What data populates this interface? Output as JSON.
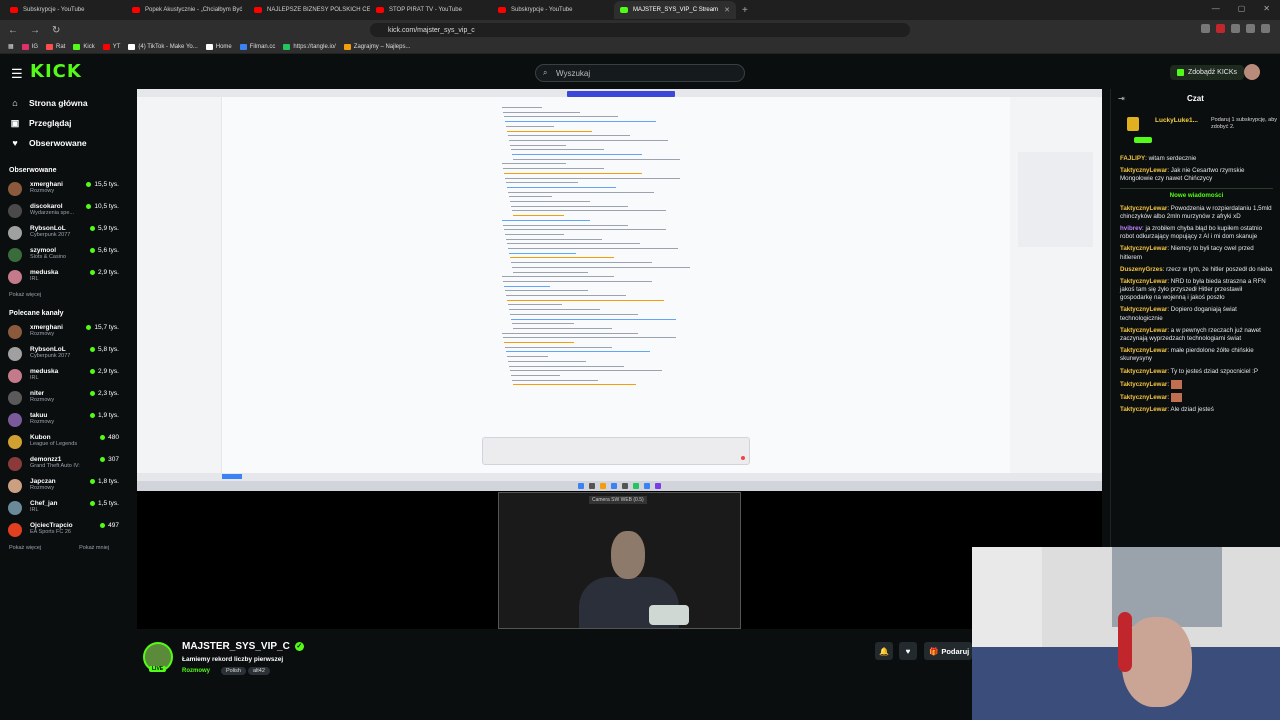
{
  "browser": {
    "tabs": [
      {
        "title": "Subskrypcje - YouTube",
        "color": "#ff0000",
        "active": false
      },
      {
        "title": "Popek Akustycznie - „Chciałbym Być",
        "color": "#ff0000",
        "active": false
      },
      {
        "title": "NAJLEPSZE BIZNESY POLSKICH CELE",
        "color": "#ff0000",
        "active": false
      },
      {
        "title": "STOP PIRAT TV - YouTube",
        "color": "#ff0000",
        "active": false
      },
      {
        "title": "Subskrypcje - YouTube",
        "color": "#ff0000",
        "active": false
      },
      {
        "title": "MAJSTER_SYS_VIP_C Stream",
        "color": "#53fc18",
        "active": true
      }
    ],
    "url": "kick.com/majster_sys_vip_c",
    "bookmarks": [
      {
        "label": "IG",
        "color": "#e1306c"
      },
      {
        "label": "Rat",
        "color": "#ff4d4d"
      },
      {
        "label": "Kick",
        "color": "#53fc18"
      },
      {
        "label": "YT",
        "color": "#ff0000"
      },
      {
        "label": "(4) TikTok - Make Yo...",
        "color": "#ffffff"
      },
      {
        "label": "Home",
        "color": "#ffffff"
      },
      {
        "label": "Filman.cc",
        "color": "#3b82f6"
      },
      {
        "label": "https://tangle.io/",
        "color": "#22c55e"
      },
      {
        "label": "Zagrajmy – Najleps...",
        "color": "#f59e0b"
      }
    ]
  },
  "header": {
    "logo": "KICK",
    "search_placeholder": "Wyszukaj",
    "kicks_label": "Zdobądź KICKs"
  },
  "sidebar": {
    "nav": [
      {
        "label": "Strona główna",
        "icon": "⌂"
      },
      {
        "label": "Przeglądaj",
        "icon": "▣"
      },
      {
        "label": "Obserwowane",
        "icon": "♥"
      }
    ],
    "followed_title": "Obserwowane",
    "followed": [
      {
        "name": "xmerghani",
        "cat": "Rozmowy",
        "viewers": "15,5 tys.",
        "color": "#8b5a3c"
      },
      {
        "name": "discokarol",
        "cat": "Wydarzenia spe...",
        "viewers": "10,5 tys.",
        "color": "#4a4a4a"
      },
      {
        "name": "RybsonLoL",
        "cat": "Cyberpunk 2077",
        "viewers": "5,9 tys.",
        "color": "#a0a0a0"
      },
      {
        "name": "szymool",
        "cat": "Slots & Casino",
        "viewers": "5,6 tys.",
        "color": "#3a6b3a"
      },
      {
        "name": "meduska",
        "cat": "IRL",
        "viewers": "2,9 tys.",
        "color": "#c47a8a"
      }
    ],
    "followed_more": "Pokaż więcej",
    "rec_title": "Polecane kanały",
    "recommended": [
      {
        "name": "xmerghani",
        "cat": "Rozmowy",
        "viewers": "15,7 tys.",
        "color": "#8b5a3c"
      },
      {
        "name": "RybsonLoL",
        "cat": "Cyberpunk 2077",
        "viewers": "5,8 tys.",
        "color": "#a0a0a0"
      },
      {
        "name": "meduska",
        "cat": "IRL",
        "viewers": "2,9 tys.",
        "color": "#c47a8a"
      },
      {
        "name": "niter",
        "cat": "Rozmowy",
        "viewers": "2,3 tys.",
        "color": "#5a5a5a"
      },
      {
        "name": "takuu",
        "cat": "Rozmowy",
        "viewers": "1,9 tys.",
        "color": "#7a5a9a"
      },
      {
        "name": "Kubon",
        "cat": "League of Legends",
        "viewers": "480",
        "color": "#d0a030"
      },
      {
        "name": "demonzz1",
        "cat": "Grand Theft Auto IV:...",
        "viewers": "307",
        "color": "#8a3a3a"
      },
      {
        "name": "Japczan",
        "cat": "Rozmowy",
        "viewers": "1,8 tys.",
        "color": "#caa080"
      },
      {
        "name": "Chef_jan",
        "cat": "IRL",
        "viewers": "1,5 tys.",
        "color": "#6a8a9a"
      },
      {
        "name": "OjciecTrapcio",
        "cat": "EA Sports FC 26",
        "viewers": "497",
        "color": "#e04020"
      }
    ],
    "rec_more": "Pokaż więcej",
    "rec_less": "Pokaż mniej"
  },
  "stream": {
    "channel": "MAJSTER_SYS_VIP_C",
    "title": "Łamiemy rekord liczby pierwszej",
    "category": "Rozmowy",
    "tags": [
      "Polish",
      "alt42"
    ],
    "live_badge": "LIVE",
    "gift_label": "Podaruj",
    "webcam_label": "Camera SW WEB (0.5)"
  },
  "chat": {
    "title": "Czat",
    "pinned_user": "LuckyLuke1...",
    "pinned_text": "Podaruj 1 subskrypcję, aby zdobyć 2.",
    "messages": [
      {
        "user": "FAJLIPY",
        "text": "witam serdecznie",
        "color": "c1"
      },
      {
        "user": "TaktycznyLewar",
        "text": "Jak nie Cesartwo rzymskie Mongołowie czy nawet Chińczycy",
        "color": "c1"
      }
    ],
    "new_label": "Nowe wiadomości",
    "messages2": [
      {
        "user": "TaktycznyLewar",
        "text": "Powodzenia w rozpierdalaniu 1,5mld chinczyków albo 2mln murzynów z afryki xD",
        "color": "c1"
      },
      {
        "user": "hvibrev",
        "text": "ja zrobiłem chyba błąd bo kupiłem ostatnio robot odkurzający mopujący z AI i mi dom skanuje",
        "color": "c2"
      },
      {
        "user": "TaktycznyLewar",
        "text": "Niemcy to byli tacy cwel przed hitlerem",
        "color": "c1"
      },
      {
        "user": "DuszenyGrzes",
        "text": "rzecz w tym, że hitler poszedł do nieba",
        "color": "c1"
      },
      {
        "user": "TaktycznyLewar",
        "text": "NRD to była bieda straszna a RFN jakoś tam się żyło przyszedł Hitler przestawił gospodarkę na wojenną i jakoś poszło",
        "color": "c1"
      },
      {
        "user": "TaktycznyLewar",
        "text": "Dopiero doganiają świat technologicznie",
        "color": "c1"
      },
      {
        "user": "TaktycznyLewar",
        "text": "a w pewnych rzeczach już nawet zaczynają wyprzedzach technologiami świat",
        "color": "c1"
      },
      {
        "user": "TaktycznyLewar",
        "text": "małe pierdolone żółte chińskie skurwysyny",
        "color": "c1"
      },
      {
        "user": "TaktycznyLewar",
        "text": "Ty to jesteś dziad szpocniciel :P",
        "color": "c1"
      },
      {
        "user": "TaktycznyLewar",
        "text": "",
        "color": "c1",
        "emote": true
      },
      {
        "user": "TaktycznyLewar",
        "text": "",
        "color": "c1",
        "emote": true
      },
      {
        "user": "TaktycznyLewar",
        "text": "Ale dziad jesteś",
        "color": "c1"
      }
    ]
  }
}
